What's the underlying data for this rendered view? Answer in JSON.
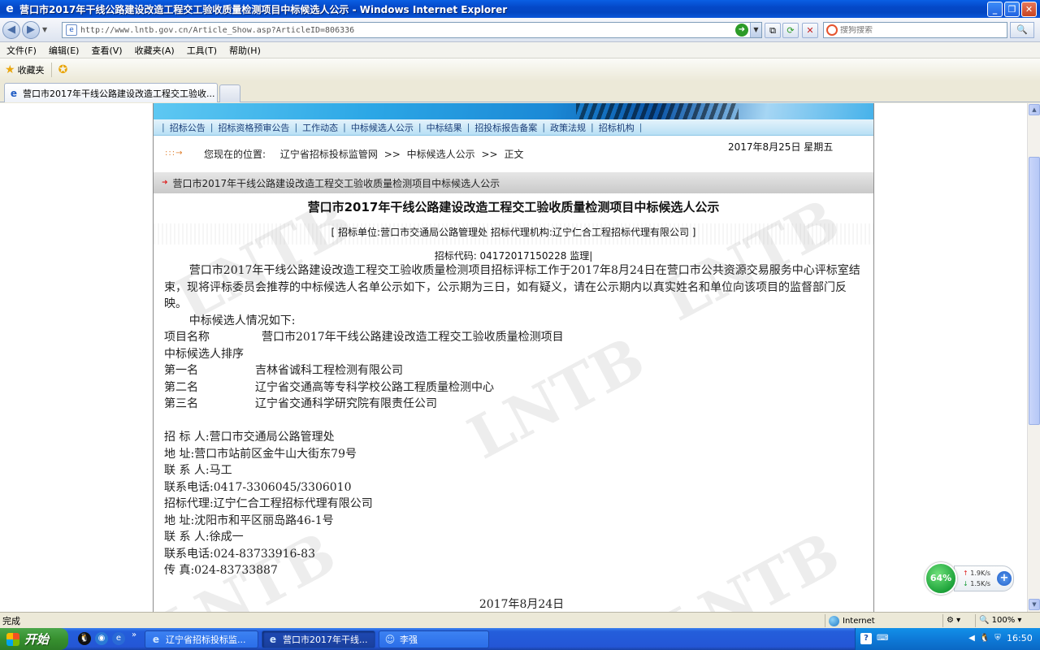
{
  "window": {
    "title": "营口市2017年干线公路建设改造工程交工验收质量检测项目中标候选人公示 - Windows Internet Explorer"
  },
  "address": {
    "url": "http://www.lntb.gov.cn/Article_Show.asp?ArticleID=806336",
    "search_placeholder": "搜狗搜索"
  },
  "menu": [
    "文件(F)",
    "编辑(E)",
    "查看(V)",
    "收藏夹(A)",
    "工具(T)",
    "帮助(H)"
  ],
  "favorites": {
    "label": "收藏夹"
  },
  "tab": {
    "title": "营口市2017年干线公路建设改造工程交工验收..."
  },
  "site": {
    "nav": [
      "招标公告",
      "招标资格预审公告",
      "工作动态",
      "中标候选人公示",
      "中标结果",
      "招投标报告备案",
      "政策法规",
      "招标机构"
    ],
    "location_label": "您现在的位置:",
    "breadcrumb": [
      "辽宁省招标投标监管网",
      ">>",
      "中标候选人公示",
      ">>",
      "正文"
    ],
    "date": "2017年8月25日  星期五",
    "section_title": "营口市2017年干线公路建设改造工程交工验收质量检测项目中标候选人公示",
    "watermark": "LNTB"
  },
  "article": {
    "title": "营口市2017年干线公路建设改造工程交工验收质量检测项目中标候选人公示",
    "meta": "[ 招标单位:营口市交通局公路管理处      招标代理机构:辽宁仁合工程招标代理有限公司 ]",
    "code": "招标代码: 04172017150228 监理|",
    "intro": "营口市2017年干线公路建设改造工程交工验收质量检测项目招标评标工作于2017年8月24日在营口市公共资源交易服务中心评标室结束，现将评标委员会推荐的中标候选人名单公示如下，公示期为三日，如有疑义，请在公示期内以真实姓名和单位向该项目的监督部门反映。",
    "candidates_intro": "中标候选人情况如下:",
    "project_label": "项目名称",
    "project_name": "营口市2017年干线公路建设改造工程交工验收质量检测项目",
    "ranking_label": "中标候选人排序",
    "candidates": [
      {
        "rank": "第一名",
        "name": "吉林省诚科工程检测有限公司"
      },
      {
        "rank": "第二名",
        "name": "辽宁省交通高等专科学校公路工程质量检测中心"
      },
      {
        "rank": "第三名",
        "name": "辽宁省交通科学研究院有限责任公司"
      }
    ],
    "contacts": [
      "招  标  人:营口市交通局公路管理处",
      "地      址:营口市站前区金牛山大街东79号",
      "联  系  人:马工",
      "联系电话:0417-3306045/3306010",
      "招标代理:辽宁仁合工程招标代理有限公司",
      "地      址:沈阳市和平区丽岛路46-1号",
      "联  系  人:徐成一",
      "联系电话:024-83733916-83",
      "传      真:024-83733887"
    ],
    "date": "2017年8月24日"
  },
  "netwidget": {
    "percent": "64%",
    "up": "1.9K/s",
    "down": "1.5K/s"
  },
  "status": {
    "text": "完成",
    "zone": "Internet",
    "zoom": "100%"
  },
  "taskbar": {
    "start": "开始",
    "items": [
      "辽宁省招标投标监...",
      "营口市2017年干线...",
      "李强"
    ],
    "clock": "16:50"
  }
}
